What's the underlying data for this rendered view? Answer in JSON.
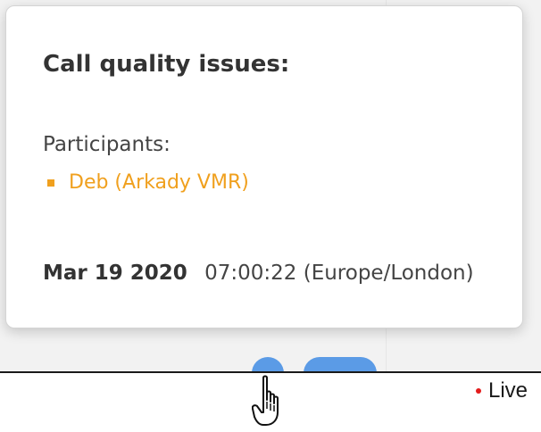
{
  "tooltip": {
    "title": "Call quality issues:",
    "participants_label": "Participants:",
    "participants": [
      {
        "name": "Deb (Arkady VMR)"
      }
    ],
    "date": "Mar 19 2020",
    "time": "07:00:22 (Europe/London)"
  },
  "timeline": {
    "live_label": "Live"
  },
  "colors": {
    "participant_accent": "#f0a01e",
    "marker_blue": "#5b9be6",
    "live_dot": "#e31b1b"
  },
  "icons": {
    "cursor": "hand-pointer-icon",
    "live": "live-dot-icon",
    "bullet": "square-bullet-icon"
  }
}
